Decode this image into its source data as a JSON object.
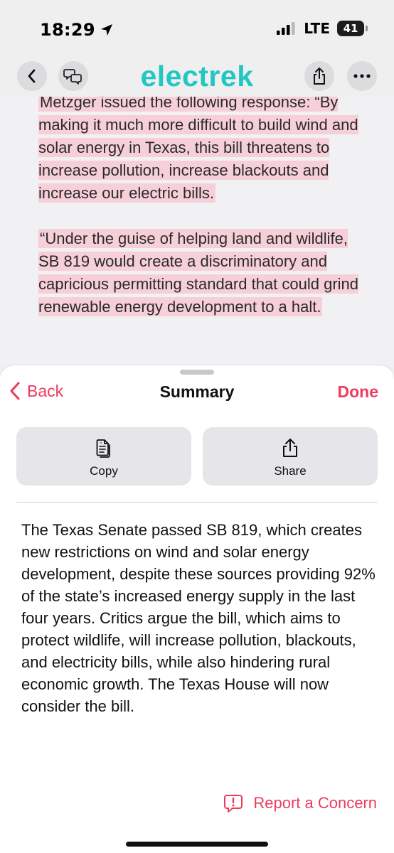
{
  "status_bar": {
    "time": "18:29",
    "network": "LTE",
    "battery_level": "41"
  },
  "header": {
    "logo_text": "electrek",
    "logo_color": "#22c7c4",
    "icons": [
      "chevron-left-icon",
      "reader-speech-bubbles-icon",
      "share-icon",
      "more-icon"
    ]
  },
  "article": {
    "paragraphs": [
      "Metzger issued the following response: “By making it much more difficult to build wind and solar energy in Texas, this bill threatens to increase pollution, increase blackouts and increase our electric bills.",
      "“Under the guise of helping land and wildlife, SB 819 would create a discriminatory and capricious permitting standard that could grind renewable energy development to a halt."
    ],
    "highlight_color": "#f7cfd9"
  },
  "sheet": {
    "back_label": "Back",
    "title": "Summary",
    "done_label": "Done",
    "accent_color": "#ee3a5d",
    "actions": {
      "copy_label": "Copy",
      "share_label": "Share"
    },
    "summary": "The Texas Senate passed SB 819, which creates new restrictions on wind and solar energy development, despite these sources providing 92% of the state’s increased energy supply in the last four years. Critics argue the bill, which aims to protect wildlife, will increase pollution, blackouts, and electricity bills, while also hindering rural economic growth. The Texas House will now consider the bill.",
    "report_label": "Report a Concern"
  }
}
